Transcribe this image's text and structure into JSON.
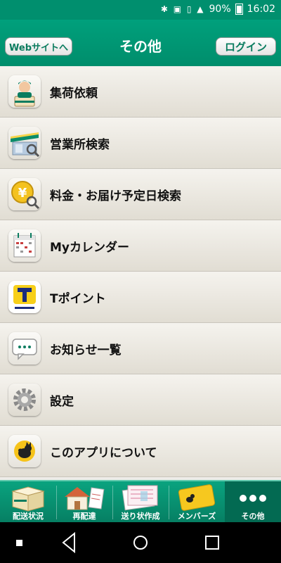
{
  "status_bar": {
    "battery_text": "90%",
    "time": "16:02"
  },
  "header": {
    "title": "その他",
    "website_button": "Webサイトへ",
    "login_button": "ログイン"
  },
  "menu_items": [
    {
      "label": "集荷依頼",
      "icon": "courier-person-icon"
    },
    {
      "label": "営業所検索",
      "icon": "office-search-icon"
    },
    {
      "label": "料金・お届け予定日検索",
      "icon": "yen-search-icon"
    },
    {
      "label": "Myカレンダー",
      "icon": "calendar-icon"
    },
    {
      "label": "Tポイント",
      "icon": "t-point-icon"
    },
    {
      "label": "お知らせ一覧",
      "icon": "speech-bubble-icon"
    },
    {
      "label": "設定",
      "icon": "gear-icon"
    },
    {
      "label": "このアプリについて",
      "icon": "kuroneko-logo-icon"
    }
  ],
  "tabs": [
    {
      "label": "配送状況",
      "active": false
    },
    {
      "label": "再配達",
      "active": false
    },
    {
      "label": "送り状作成",
      "active": false
    },
    {
      "label": "メンバーズ",
      "active": false
    },
    {
      "label": "その他",
      "active": true
    }
  ],
  "colors": {
    "brand_green": "#008f6e",
    "tab_active": "#036a52"
  }
}
